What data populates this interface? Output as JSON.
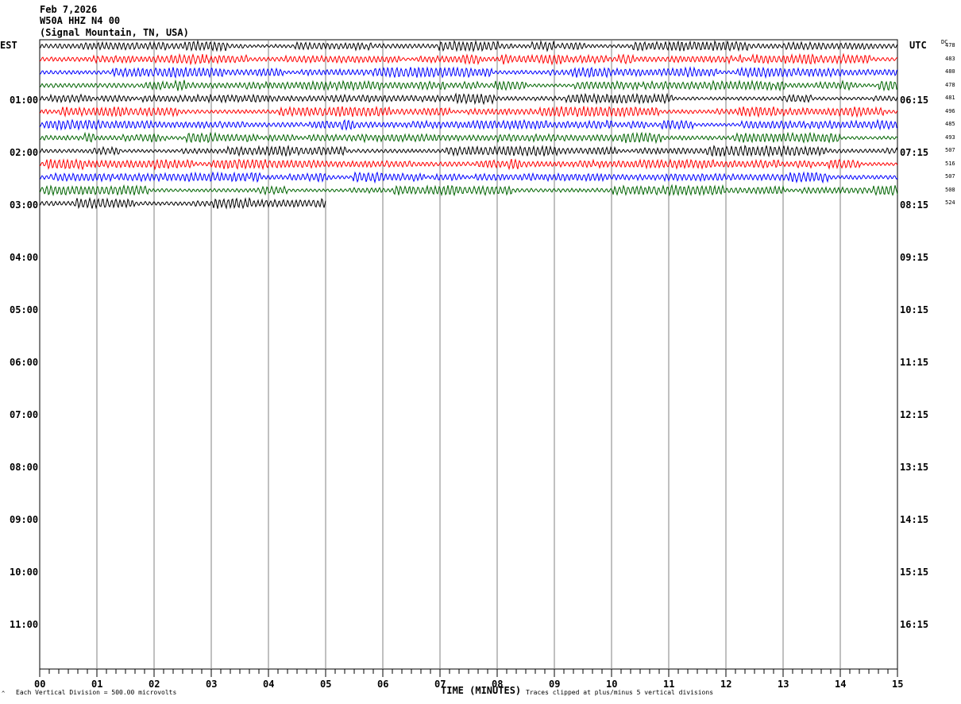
{
  "header": {
    "date": "Feb 7,2026",
    "station": "W50A HHZ N4 00",
    "location": "(Signal Mountain, TN, USA)"
  },
  "left_tz": "EST",
  "right_tz": "UTC",
  "dc_label": "DC",
  "footer": {
    "scale_note": "Each Vertical Division =  500.00 microvolts",
    "clip_note": "Traces clipped at plus/minus 5 vertical divisions",
    "mark": "^"
  },
  "chart_data": {
    "type": "line",
    "subtype": "helicorder",
    "xlabel": "TIME (MINUTES)",
    "x_ticks": [
      "00",
      "01",
      "02",
      "03",
      "04",
      "05",
      "06",
      "07",
      "08",
      "09",
      "10",
      "11",
      "12",
      "13",
      "14",
      "15"
    ],
    "xlim": [
      0,
      15
    ],
    "grid": "vertical lines every minute",
    "trace_colors": [
      "#000000",
      "#ff0000",
      "#0000ff",
      "#006400"
    ],
    "left_hour_labels": [
      "01:00",
      "02:00",
      "03:00",
      "04:00",
      "05:00",
      "06:00",
      "07:00",
      "08:00",
      "09:00",
      "10:00",
      "11:00"
    ],
    "right_hour_labels": [
      "06:15",
      "07:15",
      "08:15",
      "09:15",
      "10:15",
      "11:15",
      "12:15",
      "13:15",
      "14:15",
      "15:15",
      "16:15"
    ],
    "dc_offsets": [
      478,
      483,
      480,
      478,
      481,
      496,
      485,
      493,
      507,
      516,
      507,
      508,
      524
    ],
    "last_row_minutes": 5
  }
}
